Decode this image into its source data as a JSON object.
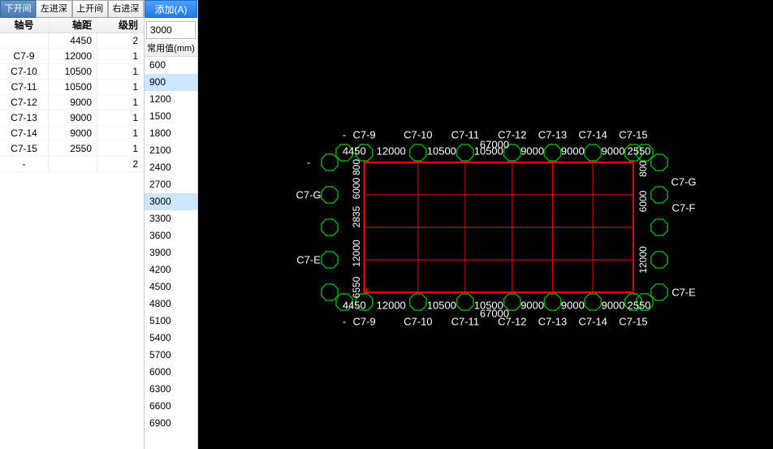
{
  "tabs": [
    "下开间",
    "左进深",
    "上开间",
    "右进深"
  ],
  "active_tab_index": 0,
  "table": {
    "headers": [
      "轴号",
      "轴距",
      "级别"
    ],
    "rows": [
      {
        "axis": "",
        "dist": "4450",
        "level": "2"
      },
      {
        "axis": "C7-9",
        "dist": "12000",
        "level": "1"
      },
      {
        "axis": "C7-10",
        "dist": "10500",
        "level": "1"
      },
      {
        "axis": "C7-11",
        "dist": "10500",
        "level": "1"
      },
      {
        "axis": "C7-12",
        "dist": "9000",
        "level": "1"
      },
      {
        "axis": "C7-13",
        "dist": "9000",
        "level": "1"
      },
      {
        "axis": "C7-14",
        "dist": "9000",
        "level": "1"
      },
      {
        "axis": "C7-15",
        "dist": "2550",
        "level": "1"
      },
      {
        "axis": "-",
        "dist": "",
        "level": "2"
      }
    ]
  },
  "add_button": "添加(A)",
  "current_value": "3000",
  "common_label": "常用值(mm)",
  "common_values": [
    "600",
    "900",
    "1200",
    "1500",
    "1800",
    "2100",
    "2400",
    "2700",
    "3000",
    "3300",
    "3600",
    "3900",
    "4200",
    "4500",
    "4800",
    "5100",
    "5400",
    "5700",
    "6000",
    "6300",
    "6600",
    "6900"
  ],
  "common_selected": [
    "900",
    "3000"
  ],
  "plan": {
    "colors": {
      "grid": "#ff0000",
      "bubble": "#00aa00",
      "dim": "#ffffff"
    },
    "total_width_label": "67000",
    "h_axes": [
      "C7-9",
      "C7-10",
      "C7-11",
      "C7-12",
      "C7-13",
      "C7-14",
      "C7-15"
    ],
    "h_dims": [
      "4450",
      "12000",
      "10500",
      "10500",
      "9000",
      "9000",
      "9000",
      "2550"
    ],
    "v_axes_left": [
      "-",
      "C7-G",
      "",
      "C7-E"
    ],
    "v_axes_right": [
      "C7-G",
      "C7-F",
      "C7-E"
    ],
    "v_dims": [
      "6550",
      "12000",
      "2835",
      "6000",
      "800"
    ],
    "right_dims": [
      "12000",
      "6000",
      "800"
    ]
  }
}
